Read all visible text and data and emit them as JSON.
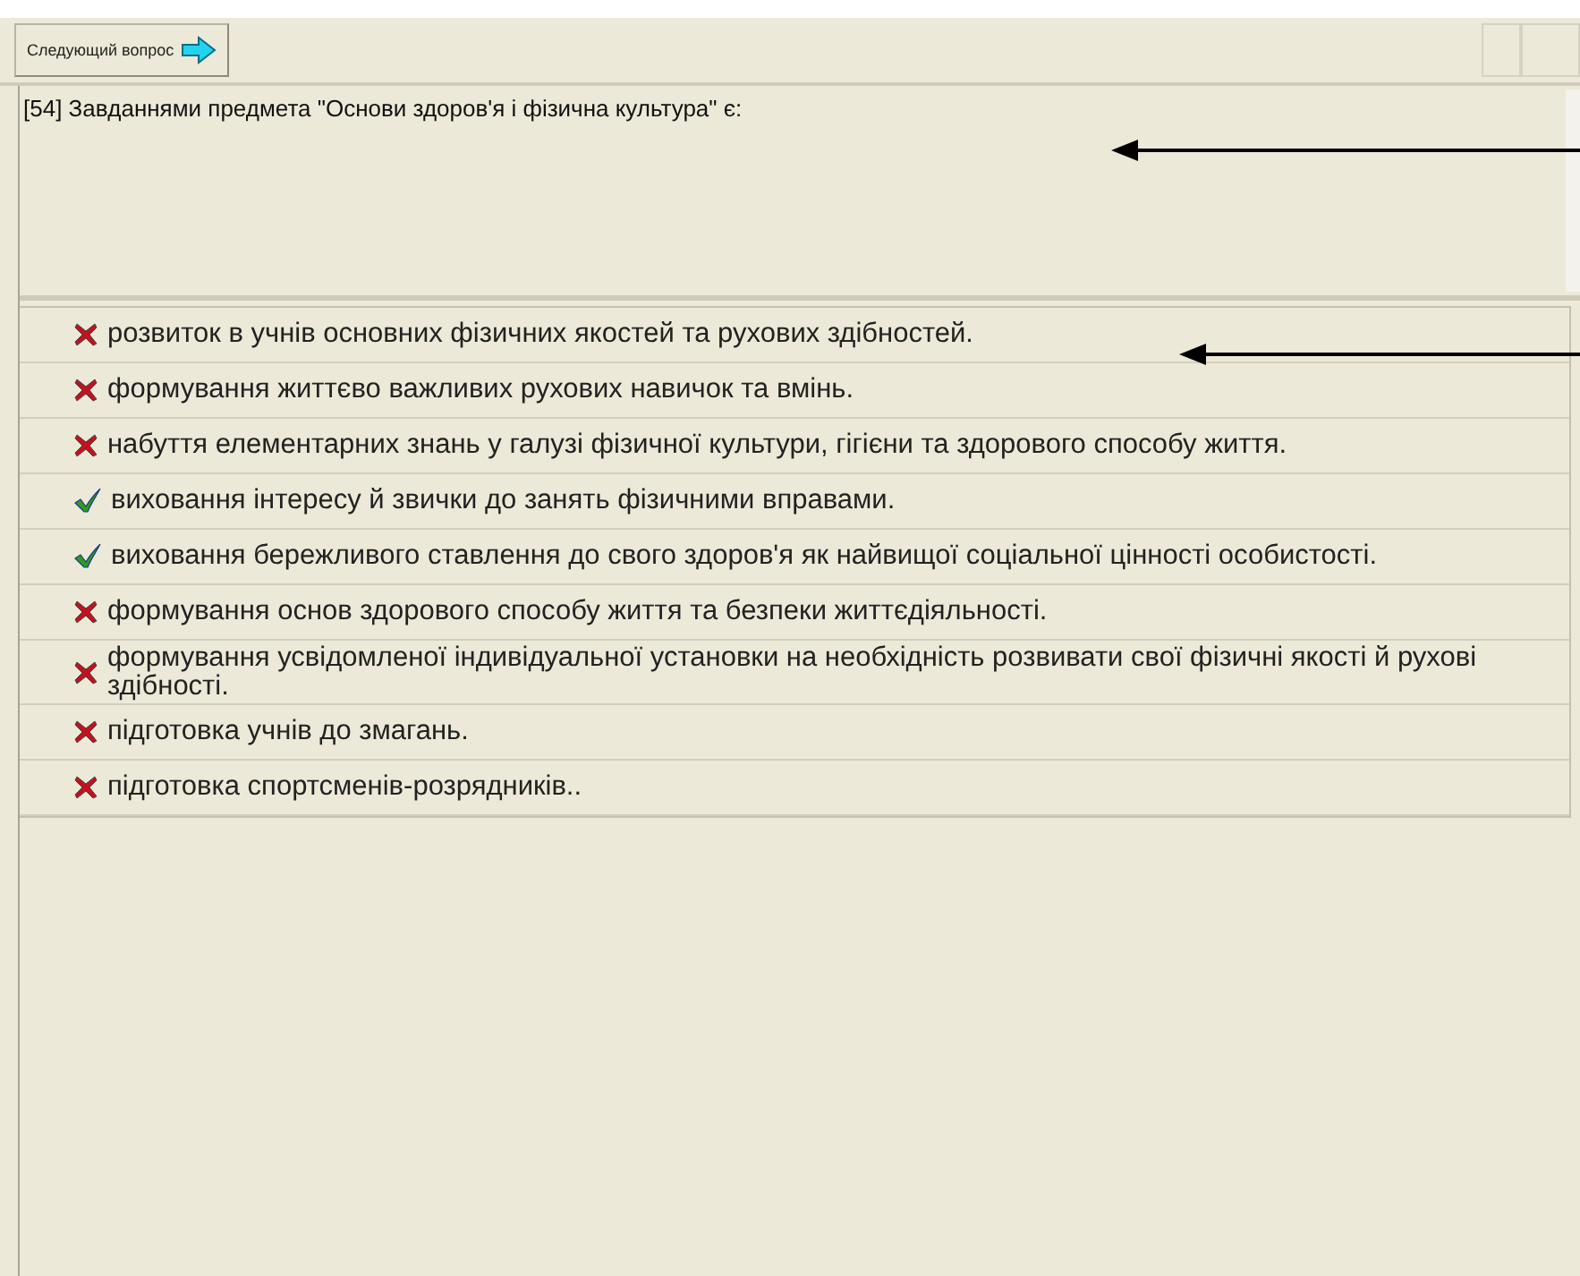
{
  "toolbar": {
    "next_button": "Следующий вопрос"
  },
  "question": {
    "text": "[54] Завданнями предмета \"Основи здоров'я і фізична культура\" є:"
  },
  "answers": [
    {
      "text": "розвиток в учнів основних фізичних якостей та рухових здібностей.",
      "correct": false
    },
    {
      "text": "формування життєво важливих рухових навичок та вмінь.",
      "correct": false
    },
    {
      "text": "набуття елементарних знань у галузі фізичної культури, гігієни та здорового способу життя.",
      "correct": false
    },
    {
      "text": "виховання інтересу й звички до занять фізичними вправами.",
      "correct": true
    },
    {
      "text": "виховання бережливого ставлення до свого здоров'я як найвищої соціальної цінності особистості.",
      "correct": true
    },
    {
      "text": "формування основ здорового способу життя та безпеки життєдіяльності.",
      "correct": false
    },
    {
      "text": "формування усвідомленої індивідуальної установки на необхідність розвивати свої фізичні якості й рухові здібності.",
      "correct": false
    },
    {
      "text": "підготовка учнів до змагань.",
      "correct": false
    },
    {
      "text": "підготовка спортсменів-розрядників..",
      "correct": false
    }
  ]
}
